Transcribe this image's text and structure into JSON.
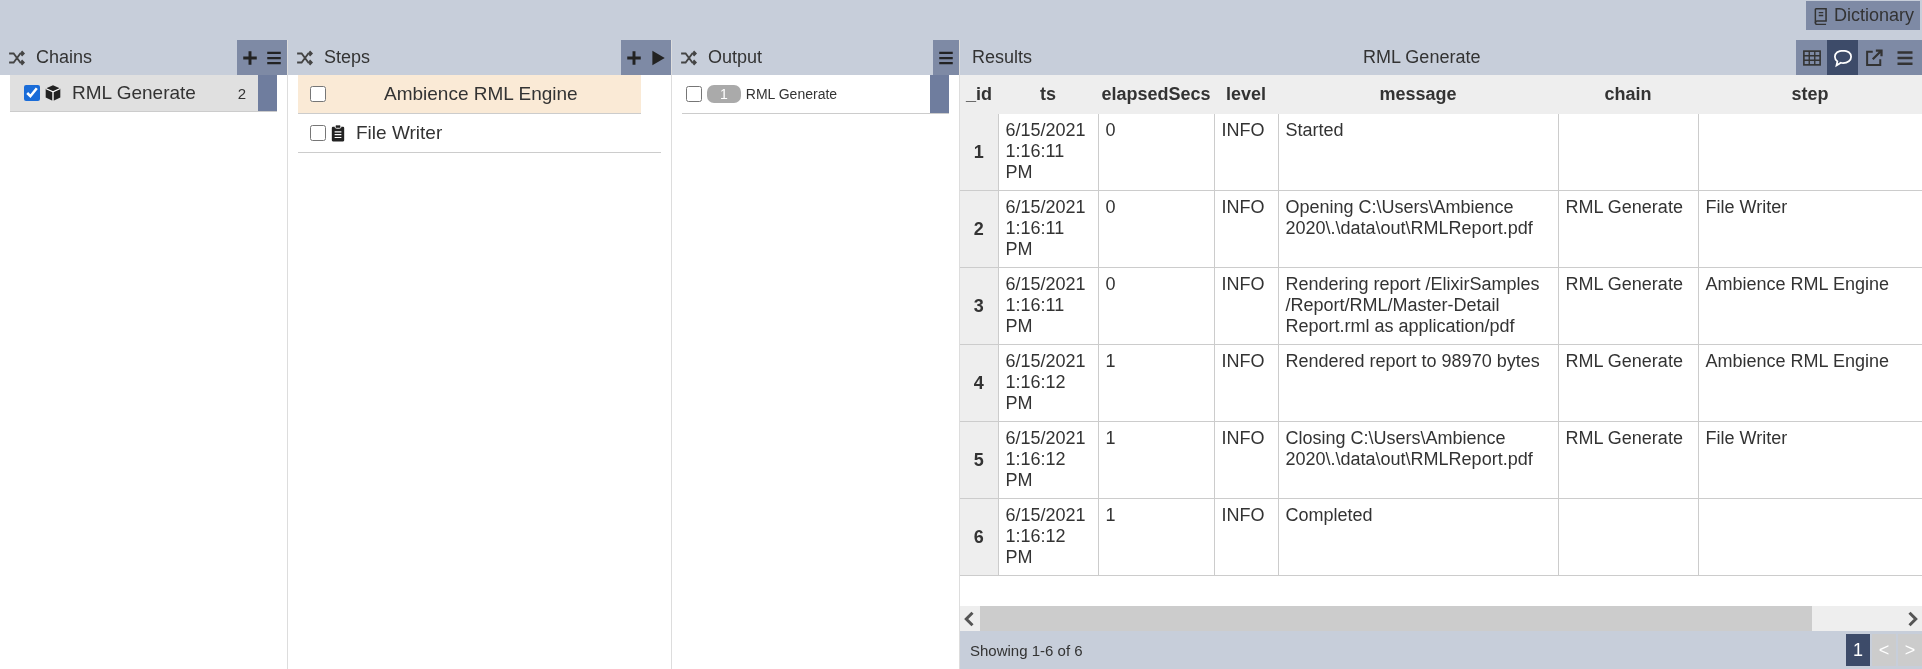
{
  "top_bar": {
    "dictionary_button": "Dictionary"
  },
  "chains": {
    "title": "Chains",
    "items": [
      {
        "label": "RML Generate",
        "count": "2",
        "checked": true,
        "selected": true
      }
    ]
  },
  "steps": {
    "title": "Steps",
    "items": [
      {
        "label": "Ambience RML Engine",
        "kind": "engine",
        "checked": false,
        "selected": true
      },
      {
        "label": "File Writer",
        "kind": "writer",
        "checked": false,
        "selected": false
      }
    ]
  },
  "output": {
    "title": "Output",
    "items": [
      {
        "label": "RML Generate",
        "badge": "1",
        "checked": false
      }
    ]
  },
  "results": {
    "title": "Results",
    "subtitle": "RML Generate",
    "views": [
      {
        "kind": "grid",
        "selected": false
      },
      {
        "kind": "comment",
        "selected": true
      },
      {
        "kind": "external",
        "selected": false
      },
      {
        "kind": "menu",
        "selected": false
      }
    ],
    "table": {
      "columns": [
        "_id",
        "ts",
        "elapsedSecs",
        "level",
        "message",
        "chain",
        "step"
      ],
      "rows": [
        [
          "1",
          "6/15/2021 1:16:11 PM",
          "0",
          "INFO",
          "Started",
          "",
          ""
        ],
        [
          "2",
          "6/15/2021 1:16:11 PM",
          "0",
          "INFO",
          "Opening C:\\Users\\Ambience 2020\\.\\data\\out\\RMLReport.pdf",
          "RML Generate",
          "File Writer"
        ],
        [
          "3",
          "6/15/2021 1:16:11 PM",
          "0",
          "INFO",
          "Rendering report /ElixirSamples /Report/RML/Master-Detail Report.rml as application/pdf",
          "RML Generate",
          "Ambience RML Engine"
        ],
        [
          "4",
          "6/15/2021 1:16:12 PM",
          "1",
          "INFO",
          "Rendered report to 98970 bytes",
          "RML Generate",
          "Ambience RML Engine"
        ],
        [
          "5",
          "6/15/2021 1:16:12 PM",
          "1",
          "INFO",
          "Closing C:\\Users\\Ambience 2020\\.\\data\\out\\RMLReport.pdf",
          "RML Generate",
          "File Writer"
        ],
        [
          "6",
          "6/15/2021 1:16:12 PM",
          "1",
          "INFO",
          "Completed",
          "",
          ""
        ]
      ]
    },
    "footer": {
      "status": "Showing 1-6 of 6",
      "pages": [
        {
          "label": "1",
          "selected": true
        }
      ],
      "prev": "<",
      "next": ">"
    }
  }
}
